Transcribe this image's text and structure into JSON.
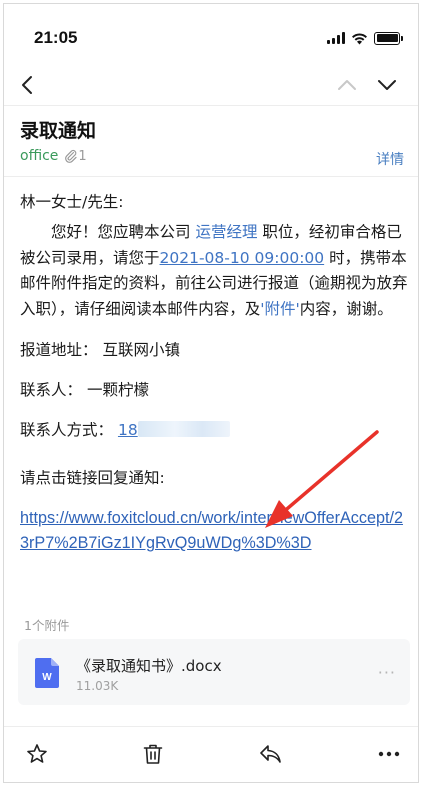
{
  "status_bar": {
    "time": "21:05"
  },
  "email": {
    "subject": "录取通知",
    "sender": "office",
    "attachment_count": "1",
    "details_label": "详情",
    "greeting": "林一女士/先生:",
    "para": {
      "p1": "您好！您应聘本公司 ",
      "position": "运营经理",
      "p2": " 职位，经初审合格已被公司录用，请您于",
      "datetime": "2021-08-10 09:00:00",
      "p3": " 时，携带本邮件附件指定的资料，前往公司进行报道（逾期视为放弃入职），请仔细阅读本邮件内容，及",
      "attachment_ref": "'附件'",
      "p4": "内容，谢谢。"
    },
    "address_label": "报道地址：",
    "address": "互联网小镇",
    "contact_label": "联系人：",
    "contact": "一颗柠檬",
    "phone_label": "联系人方式：",
    "phone_visible": "18",
    "reply_prompt": "请点击链接回复通知:",
    "link": "https://www.foxitcloud.cn/work/interviewOfferAccept/23rP7%2B7iGz1IYgRvQ9uWDg%3D%3D"
  },
  "attachments": {
    "count_label": "1个附件",
    "items": [
      {
        "name": "《录取通知书》.docx",
        "size": "11.03K",
        "more": "···",
        "icon_letter": "W"
      }
    ]
  },
  "colors": {
    "sender_green": "#3a9a5b",
    "link_blue": "#2f63b8",
    "arrow_red": "#e8322a",
    "word_icon": "#4f6ef0"
  },
  "icons": {
    "back": "chevron-left-icon",
    "prev": "chevron-up-icon",
    "next": "chevron-down-icon",
    "paperclip": "paperclip-icon",
    "star": "star-icon",
    "delete": "trash-icon",
    "reply": "reply-icon",
    "more": "more-icon"
  }
}
